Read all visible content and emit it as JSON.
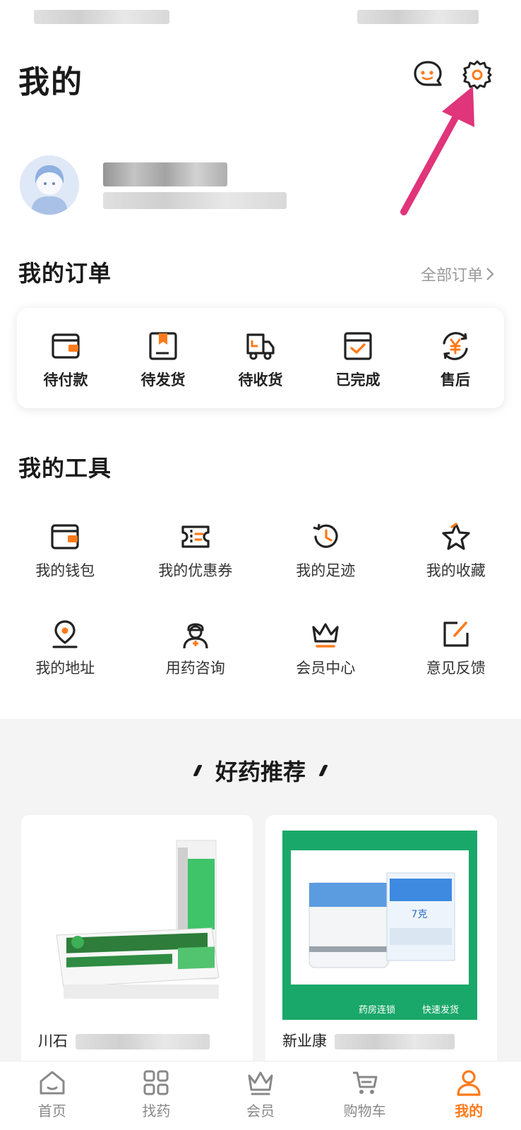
{
  "header": {
    "title": "我的",
    "chat_icon": "chat-bubble-icon",
    "settings_icon": "gear-icon"
  },
  "orders": {
    "title": "我的订单",
    "all_link": "全部订单",
    "items": [
      {
        "label": "待付款",
        "icon": "wallet-icon"
      },
      {
        "label": "待发货",
        "icon": "package-icon"
      },
      {
        "label": "待收货",
        "icon": "truck-icon"
      },
      {
        "label": "已完成",
        "icon": "check-box-icon"
      },
      {
        "label": "售后",
        "icon": "refund-icon"
      }
    ]
  },
  "tools": {
    "title": "我的工具",
    "items": [
      {
        "label": "我的钱包",
        "icon": "wallet-icon"
      },
      {
        "label": "我的优惠券",
        "icon": "coupon-icon"
      },
      {
        "label": "我的足迹",
        "icon": "history-icon"
      },
      {
        "label": "我的收藏",
        "icon": "star-icon"
      },
      {
        "label": "我的地址",
        "icon": "location-pin-icon"
      },
      {
        "label": "用药咨询",
        "icon": "doctor-icon"
      },
      {
        "label": "会员中心",
        "icon": "crown-icon"
      },
      {
        "label": "意见反馈",
        "icon": "feedback-edit-icon"
      }
    ]
  },
  "recommend": {
    "title": "好药推荐",
    "products": [
      {
        "name": "川石"
      },
      {
        "name": "新业康"
      }
    ],
    "badges": [
      "药房连锁",
      "快速发货"
    ],
    "product_size_label": "7克"
  },
  "tabbar": {
    "items": [
      {
        "label": "首页",
        "icon": "home-icon"
      },
      {
        "label": "找药",
        "icon": "grid-icon"
      },
      {
        "label": "会员",
        "icon": "crown-icon"
      },
      {
        "label": "购物车",
        "icon": "cart-icon"
      },
      {
        "label": "我的",
        "icon": "user-icon"
      }
    ],
    "active_index": 4
  },
  "colors": {
    "accent": "#ff7a1a",
    "annotation_arrow": "#e0357a",
    "promo_green": "#1aa86a"
  }
}
